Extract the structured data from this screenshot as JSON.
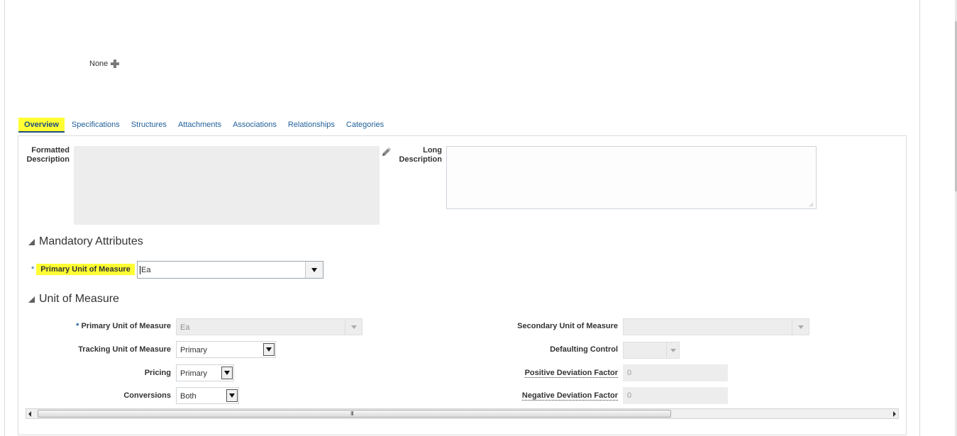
{
  "header": {
    "none_label": "None"
  },
  "tabs": [
    {
      "label": "Overview",
      "active": true
    },
    {
      "label": "Specifications"
    },
    {
      "label": "Structures"
    },
    {
      "label": "Attachments"
    },
    {
      "label": "Associations"
    },
    {
      "label": "Relationships"
    },
    {
      "label": "Categories"
    }
  ],
  "overview": {
    "formatted_description_label_1": "Formatted",
    "formatted_description_label_2": "Description",
    "long_description_label_1": "Long",
    "long_description_label_2": "Description",
    "long_description_value": ""
  },
  "mandatory_attributes": {
    "title": "Mandatory Attributes",
    "required_marker": "*",
    "primary_uom_label": "Primary Unit of Measure",
    "primary_uom_value": "Ea"
  },
  "unit_of_measure": {
    "title": "Unit of Measure",
    "required_marker": "*",
    "primary_uom_label": "Primary Unit of Measure",
    "primary_uom_value": "Ea",
    "tracking_uom_label": "Tracking Unit of Measure",
    "tracking_uom_value": "Primary",
    "pricing_label": "Pricing",
    "pricing_value": "Primary",
    "conversions_label": "Conversions",
    "conversions_value": "Both",
    "secondary_uom_label": "Secondary Unit of Measure",
    "secondary_uom_value": "",
    "defaulting_control_label": "Defaulting Control",
    "defaulting_control_value": "",
    "positive_deviation_label": "Positive Deviation Factor",
    "positive_deviation_value": "0",
    "negative_deviation_label": "Negative Deviation Factor",
    "negative_deviation_value": "0"
  },
  "scrollbar": {
    "grip": "III"
  },
  "colors": {
    "highlight": "#ffff33",
    "link": "#1f5f99",
    "disabled_bg": "#ededee"
  }
}
